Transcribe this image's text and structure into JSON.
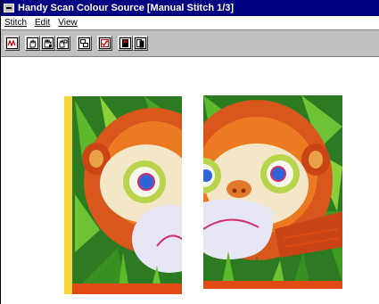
{
  "window": {
    "title": "Handy Scan Colour Source [Manual Stitch 1/3]"
  },
  "menu": [
    {
      "label": "Stitch"
    },
    {
      "label": "Edit"
    },
    {
      "label": "View"
    }
  ],
  "toolbar": {
    "buttons": [
      {
        "icon": "waveform-icon"
      },
      {
        "icon": "hand-grab-icon"
      },
      {
        "icon": "hand-move-icon"
      },
      {
        "icon": "hand-select-icon"
      },
      {
        "icon": "tile-icon"
      },
      {
        "icon": "checkbox-icon"
      },
      {
        "icon": "save-icon"
      },
      {
        "icon": "copy-icon"
      }
    ]
  },
  "colors": {
    "titlebar": "#000080",
    "toolbar": "#c0c0c0",
    "accent_red": "#cc0000"
  },
  "images": [
    {
      "name": "scan-left-half"
    },
    {
      "name": "scan-right-half"
    }
  ]
}
